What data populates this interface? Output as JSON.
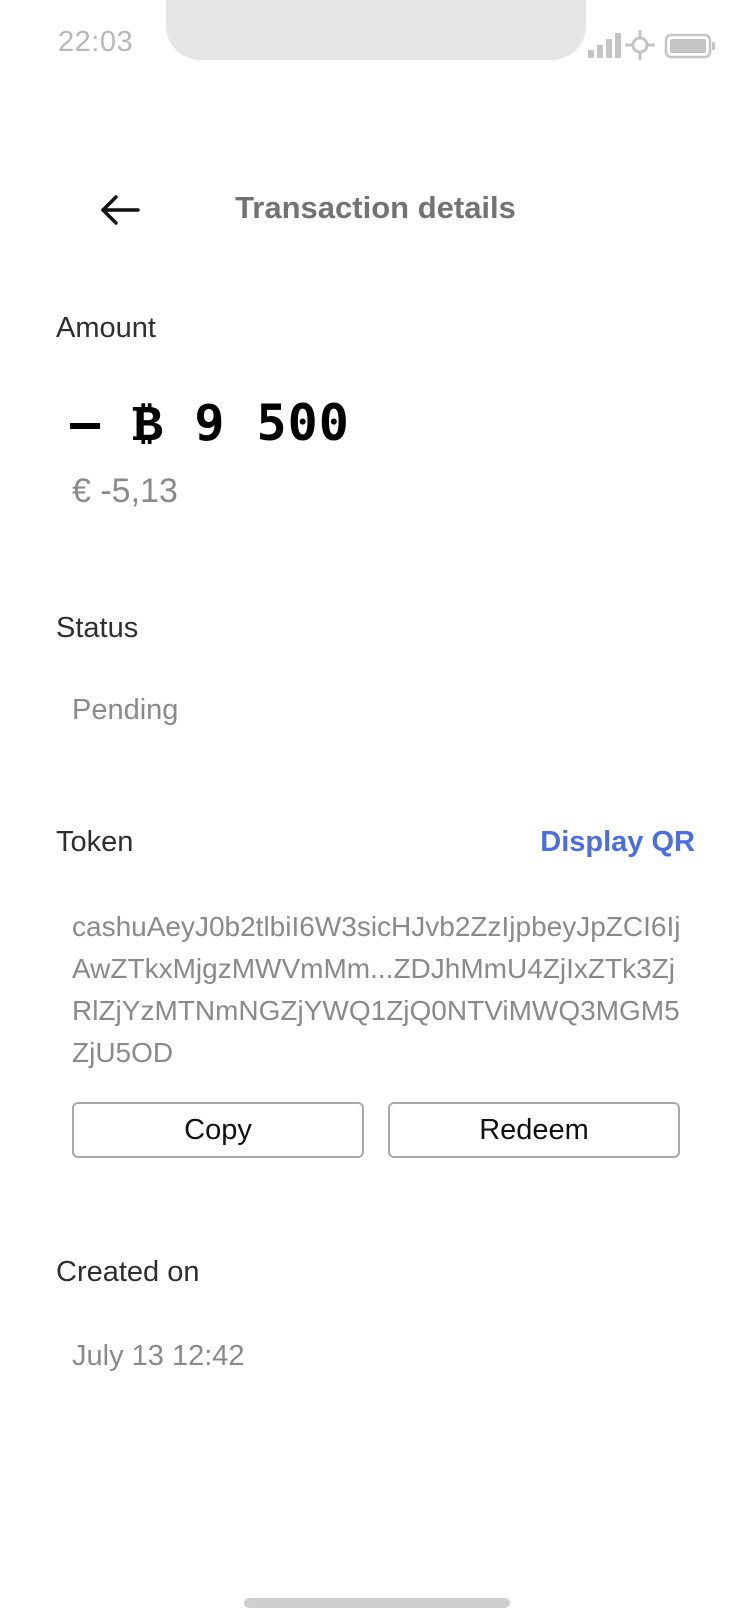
{
  "status_bar": {
    "time": "22:03",
    "icons": [
      "cellular-signal-icon",
      "network-icon",
      "battery-icon"
    ]
  },
  "header": {
    "back_icon": "arrow-left-icon",
    "title": "Transaction details"
  },
  "amount": {
    "label": "Amount",
    "value": "– ₿ 9 500",
    "fiat": "€ -5,13"
  },
  "status": {
    "label": "Status",
    "value": "Pending"
  },
  "token": {
    "label": "Token",
    "display_qr_label": "Display QR",
    "value": "cashuAeyJ0b2tlbiI6W3sicHJvb2ZzIjpbeyJpZCI6IjAwZTkxMjgzMWVmMm...ZDJhMmU4ZjIxZTk3ZjRlZjYzMTNmNGZjYWQ1ZjQ0NTViMWQ3MGM5ZjU5OD",
    "copy_label": "Copy",
    "redeem_label": "Redeem"
  },
  "created": {
    "label": "Created on",
    "value": "July 13 12:42"
  },
  "colors": {
    "accent": "#4b6fe3",
    "muted_text": "#8a8a8a",
    "title_text": "#737373"
  }
}
